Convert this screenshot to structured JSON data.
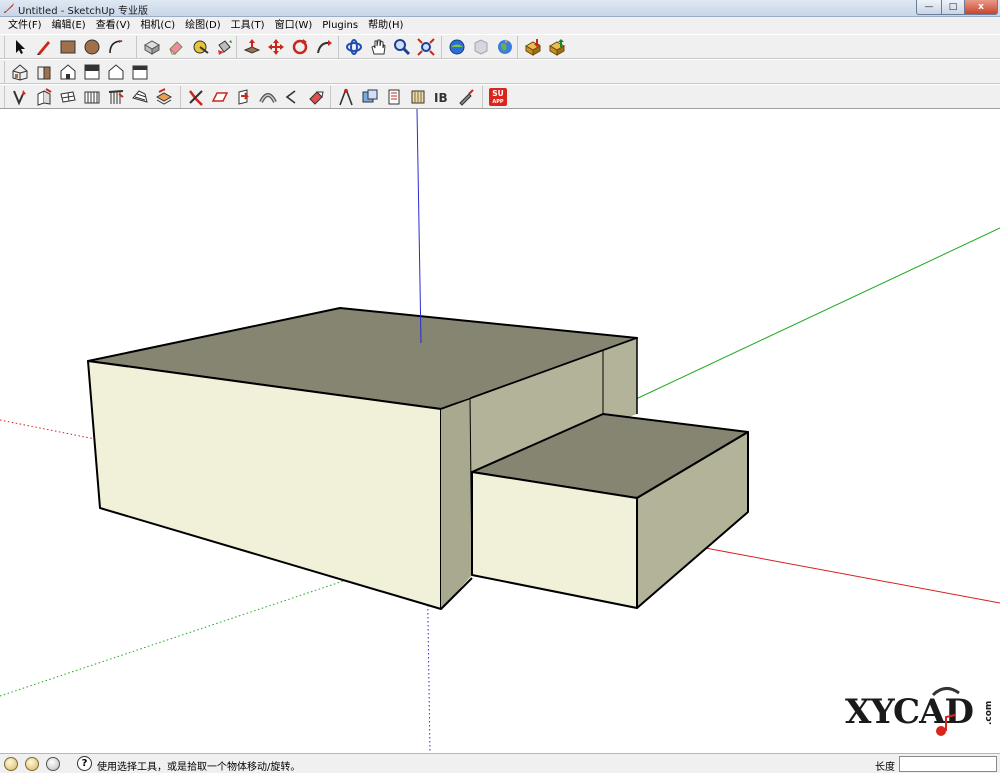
{
  "window": {
    "title": "Untitled - SketchUp 专业版",
    "controls": {
      "minimize": "—",
      "maximize": "□",
      "close": "x"
    }
  },
  "menubar": [
    "文件(F)",
    "编辑(E)",
    "查看(V)",
    "相机(C)",
    "绘图(D)",
    "工具(T)",
    "窗口(W)",
    "Plugins",
    "帮助(H)"
  ],
  "toolbars": {
    "main": [
      [
        "select-icon",
        "line-pencil-icon",
        "rectangle-icon",
        "circle-icon",
        "arc-icon"
      ],
      [
        "make-component-icon",
        "eraser-icon",
        "tape-measure-icon",
        "paint-bucket-icon"
      ],
      [
        "push-pull-icon",
        "move-icon",
        "rotate-icon",
        "follow-me-icon"
      ],
      [
        "orbit-icon",
        "pan-icon",
        "zoom-icon",
        "zoom-extents-icon"
      ],
      [
        "get-models-icon",
        "share-model-icon",
        "google-earth-icon"
      ],
      [
        "get-components-icon",
        "share-component-icon"
      ]
    ],
    "views": [
      "iso-view-icon",
      "right-view-icon",
      "front-view-icon",
      "top-view-icon",
      "back-view-icon",
      "left-view-icon"
    ],
    "plugins": [
      [
        "wall-tool-icon",
        "door-tool-icon",
        "window-tool-icon",
        "stair-tool-icon",
        "railing-tool-icon",
        "roof-tool-icon",
        "layer-tool-icon"
      ],
      [
        "fillet-icon",
        "offset-icon",
        "extrude-icon",
        "bend-icon",
        "chamfer-icon",
        "flip-icon"
      ],
      [
        "compass-icon",
        "material-icon",
        "section-icon",
        "texture-icon",
        "3d-text-icon",
        "paint-spray-icon"
      ],
      [
        "su-app-icon"
      ]
    ]
  },
  "plugin_badge": {
    "line1": "SU",
    "line2": "APP"
  },
  "watermark": {
    "brand": "XYCAD",
    "suffix": ".com"
  },
  "status": {
    "hint": "使用选择工具，或是拾取一个物体移动/旋转。",
    "help_glyph": "?",
    "measure_label": "长度",
    "measure_value": ""
  },
  "colors": {
    "face_front": "#f1f0d9",
    "face_top": "#858572",
    "face_side": "#b3b39a",
    "axis_red": "#d42020",
    "axis_green": "#1fa81f",
    "axis_blue": "#2b2bd0"
  }
}
